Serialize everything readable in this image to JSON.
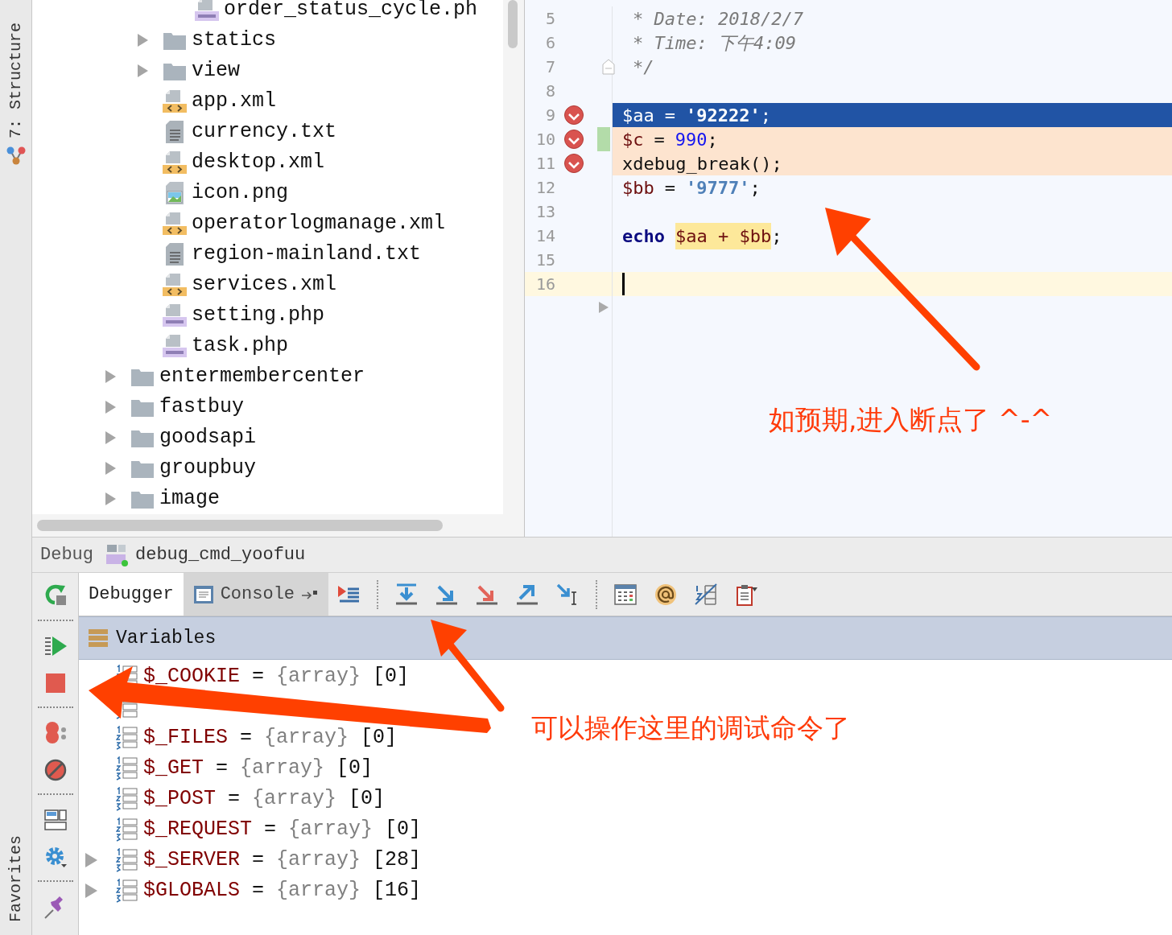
{
  "sidebar_tabs": [
    {
      "label": "7: Structure",
      "kind": "structure"
    },
    {
      "label": "Favorites",
      "kind": "favorites"
    }
  ],
  "project_tree": {
    "children": [
      {
        "children": [
          {
            "children": [
              {
                "label": "order_status_cycle.ph",
                "kind": "php"
              }
            ]
          },
          {
            "label": "statics",
            "kind": "folder",
            "expanded": false
          },
          {
            "label": "view",
            "kind": "folder",
            "expanded": false
          },
          {
            "label": "app.xml",
            "kind": "xml"
          },
          {
            "label": "currency.txt",
            "kind": "txt"
          },
          {
            "label": "desktop.xml",
            "kind": "xml"
          },
          {
            "label": "icon.png",
            "kind": "image"
          },
          {
            "label": "operatorlogmanage.xml",
            "kind": "xml"
          },
          {
            "label": "region-mainland.txt",
            "kind": "txt"
          },
          {
            "label": "services.xml",
            "kind": "xml"
          },
          {
            "label": "setting.php",
            "kind": "php"
          },
          {
            "label": "task.php",
            "kind": "php"
          }
        ]
      },
      {
        "label": "entermembercenter",
        "kind": "folder",
        "expanded": false
      },
      {
        "label": "fastbuy",
        "kind": "folder",
        "expanded": false
      },
      {
        "label": "goodsapi",
        "kind": "folder",
        "expanded": false
      },
      {
        "label": "groupbuy",
        "kind": "folder",
        "expanded": false
      },
      {
        "label": "image",
        "kind": "folder",
        "expanded": false
      }
    ]
  },
  "editor": {
    "lines": [
      {
        "number": "5",
        "breakpoint": false,
        "execution_point": false,
        "breakpoint_hit": false,
        "caret": false,
        "tokens": [
          {
            "text": "* Date: 2018/2/7",
            "kind": "comment"
          }
        ]
      },
      {
        "number": "6",
        "breakpoint": false,
        "execution_point": false,
        "breakpoint_hit": false,
        "caret": false,
        "tokens": [
          {
            "text": "* Time: 下午4:09",
            "kind": "comment"
          }
        ]
      },
      {
        "number": "7",
        "breakpoint": false,
        "execution_point": false,
        "breakpoint_hit": false,
        "caret": false,
        "fold": true,
        "tokens": [
          {
            "text": "*/",
            "kind": "comment"
          }
        ]
      },
      {
        "number": "8",
        "breakpoint": false,
        "execution_point": false,
        "breakpoint_hit": false,
        "caret": false
      },
      {
        "number": "9",
        "breakpoint": true,
        "execution_point": true,
        "breakpoint_hit": false,
        "caret": false,
        "tokens": [
          {
            "text": "$aa",
            "kind": "var"
          },
          {
            "text": "=",
            "kind": "operator"
          },
          {
            "text": "'92222'",
            "kind": "string"
          },
          {
            "text": ";",
            "kind": "plain"
          }
        ]
      },
      {
        "number": "10",
        "breakpoint": true,
        "execution_point": false,
        "breakpoint_hit": true,
        "caret": false,
        "changed": true,
        "tokens": [
          {
            "text": "$c",
            "kind": "var"
          },
          {
            "text": "=",
            "kind": "operator"
          },
          {
            "text": "990",
            "kind": "number"
          },
          {
            "text": ";",
            "kind": "plain"
          }
        ]
      },
      {
        "number": "11",
        "breakpoint": true,
        "execution_point": false,
        "breakpoint_hit": true,
        "caret": false,
        "tokens": [
          {
            "text": "xdebug_break();",
            "kind": "plain"
          }
        ]
      },
      {
        "number": "12",
        "breakpoint": false,
        "execution_point": false,
        "breakpoint_hit": false,
        "caret": false,
        "tokens": [
          {
            "text": "$bb",
            "kind": "var"
          },
          {
            "text": "=",
            "kind": "operator"
          },
          {
            "text": "'9777'",
            "kind": "string"
          },
          {
            "text": ";",
            "kind": "plain"
          }
        ]
      },
      {
        "number": "13",
        "breakpoint": false,
        "execution_point": false,
        "breakpoint_hit": false,
        "caret": false
      },
      {
        "number": "14",
        "breakpoint": false,
        "execution_point": false,
        "breakpoint_hit": false,
        "caret": false,
        "tokens": [
          {
            "text": "echo",
            "kind": "keyword"
          },
          {
            "text": "$aa + $bb",
            "kind": "marked"
          },
          {
            "text": ";",
            "kind": "plain"
          }
        ]
      },
      {
        "number": "15",
        "breakpoint": false,
        "execution_point": false,
        "breakpoint_hit": false,
        "caret": false
      },
      {
        "number": "16",
        "breakpoint": false,
        "execution_point": false,
        "breakpoint_hit": false,
        "caret": true
      }
    ]
  },
  "debug": {
    "title": "Debug",
    "configuration": "debug_cmd_yoofuu",
    "tabs": [
      {
        "label": "Debugger",
        "selected": true
      },
      {
        "label": "Console",
        "selected": false
      }
    ],
    "variables_title": "Variables",
    "variables": [
      {
        "name": "$_COOKIE",
        "separator": "=",
        "type": "{array}",
        "count": "[0]",
        "expandable": false
      },
      {
        "expandable": false
      },
      {
        "name": "$_FILES",
        "separator": "=",
        "type": "{array}",
        "count": "[0]",
        "expandable": false
      },
      {
        "name": "$_GET",
        "separator": "=",
        "type": "{array}",
        "count": "[0]",
        "expandable": false
      },
      {
        "name": "$_POST",
        "separator": "=",
        "type": "{array}",
        "count": "[0]",
        "expandable": false
      },
      {
        "name": "$_REQUEST",
        "separator": "=",
        "type": "{array}",
        "count": "[0]",
        "expandable": false
      },
      {
        "name": "$_SERVER",
        "separator": "=",
        "type": "{array}",
        "count": "[28]",
        "expandable": true
      },
      {
        "name": "$GLOBALS",
        "separator": "=",
        "type": "{array}",
        "count": "[16]",
        "expandable": true
      }
    ]
  },
  "annotations": [
    {
      "text": "如预期,进入断点了 ^-^"
    },
    {
      "text": "可以操作这里的调试命令了"
    }
  ]
}
